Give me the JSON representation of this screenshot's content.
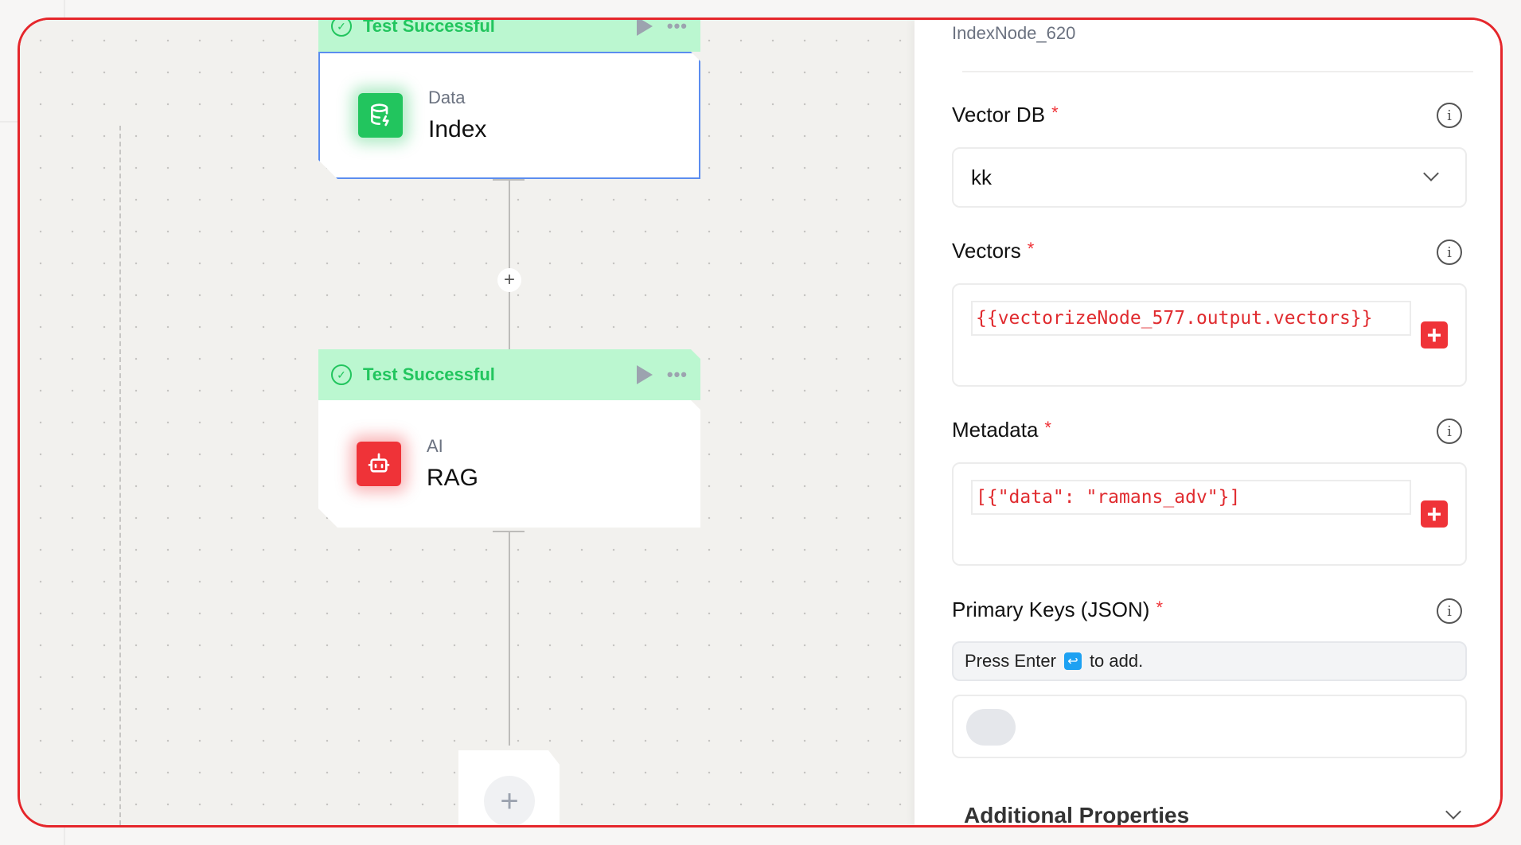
{
  "canvas": {
    "nodes": [
      {
        "status": "Test Successful",
        "category": "Data",
        "title": "Index",
        "icon": "database-bolt-icon",
        "accent": "#22c55e",
        "selected": true
      },
      {
        "status": "Test Successful",
        "category": "AI",
        "title": "RAG",
        "icon": "robot-icon",
        "accent": "#ef3338",
        "selected": false
      }
    ],
    "connector_plus": "+",
    "add_node": "+"
  },
  "panel": {
    "node_id": "IndexNode_620",
    "fields": {
      "vector_db": {
        "label": "Vector DB",
        "required": "*",
        "value": "kk"
      },
      "vectors": {
        "label": "Vectors",
        "required": "*",
        "value": "{{vectorizeNode_577.output.vectors}}"
      },
      "metadata": {
        "label": "Metadata",
        "required": "*",
        "value": "[{\"data\": \"ramans_adv\"}]"
      },
      "primary_keys": {
        "label": "Primary Keys (JSON)",
        "required": "*",
        "hint_before": "Press Enter",
        "hint_after": "to add."
      }
    },
    "additional_properties": "Additional Properties"
  },
  "icons": {
    "info": "i",
    "check": "✓",
    "plus": "+",
    "enter": "↩",
    "more": "•••"
  },
  "colors": {
    "success_bg": "#bbf7d0",
    "success_text": "#22c55e",
    "danger": "#ef3338",
    "selected_border": "#5b8def",
    "highlight_frame": "#e5262b"
  }
}
